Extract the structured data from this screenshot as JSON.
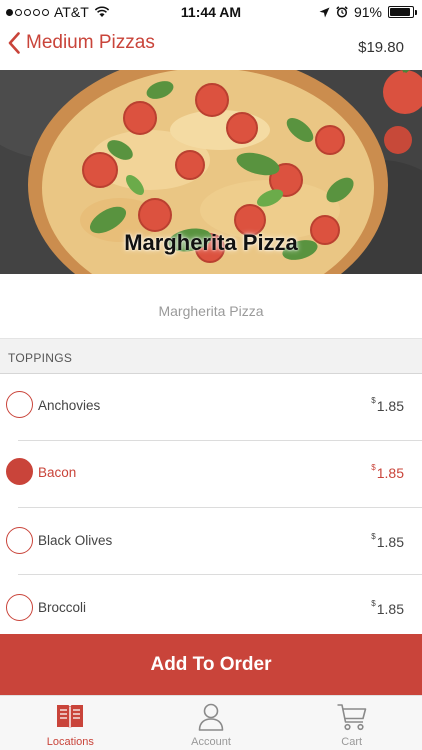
{
  "status_bar": {
    "carrier": "AT&T",
    "time": "11:44 AM",
    "battery": "91%",
    "battery_level": 0.91,
    "signal_bars_filled": 1
  },
  "nav": {
    "back_title": "Medium Pizzas",
    "price": "$19.80"
  },
  "hero": {
    "title": "Margherita Pizza"
  },
  "item": {
    "description": "Margherita Pizza"
  },
  "toppings": {
    "header": "TOPPINGS",
    "items": [
      {
        "name": "Anchovies",
        "currency": "$",
        "price": "1.85",
        "selected": false
      },
      {
        "name": "Bacon",
        "currency": "$",
        "price": "1.85",
        "selected": true
      },
      {
        "name": "Black Olives",
        "currency": "$",
        "price": "1.85",
        "selected": false
      },
      {
        "name": "Broccoli",
        "currency": "$",
        "price": "1.85",
        "selected": false
      }
    ]
  },
  "actions": {
    "add_label": "Add To Order"
  },
  "tabs": [
    {
      "label": "Locations",
      "icon": "book-icon",
      "active": true
    },
    {
      "label": "Account",
      "icon": "person-icon",
      "active": false
    },
    {
      "label": "Cart",
      "icon": "cart-icon",
      "active": false
    }
  ],
  "colors": {
    "accent": "#c9443a",
    "section_bg": "#f2f2f2",
    "muted_text": "#9a9a9a"
  }
}
